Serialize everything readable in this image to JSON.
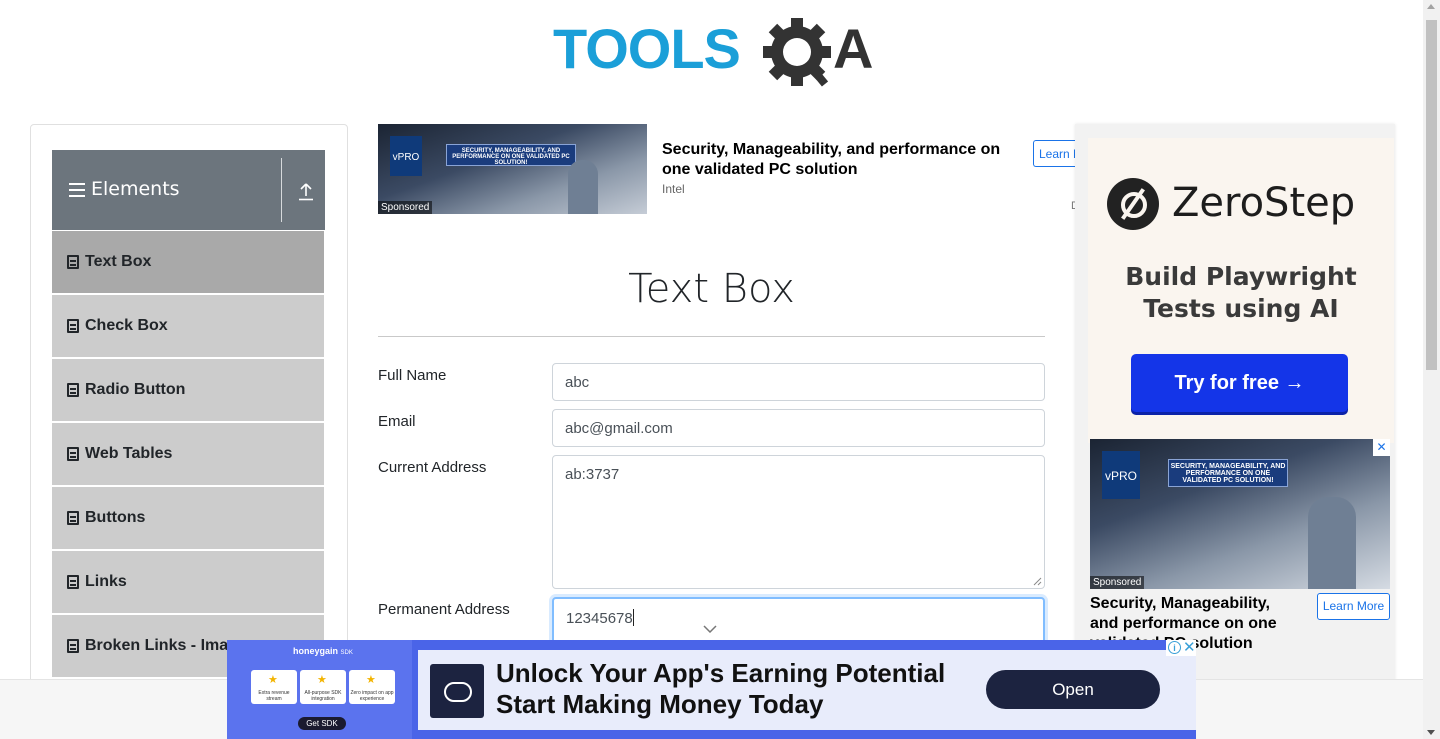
{
  "header": {
    "logo_text_a": "TOOLS",
    "logo_text_b": "A",
    "colors": {
      "logo_blue": "#1b9fd8",
      "logo_dark": "#333333"
    }
  },
  "sidebar": {
    "group_title": "Elements",
    "menu_icon": "hamburger-icon",
    "collapse_icon": "upload-icon",
    "items": [
      {
        "label": "Text Box",
        "icon": "list-icon",
        "active": true
      },
      {
        "label": "Check Box",
        "icon": "list-icon"
      },
      {
        "label": "Radio Button",
        "icon": "list-icon"
      },
      {
        "label": "Web Tables",
        "icon": "list-icon"
      },
      {
        "label": "Buttons",
        "icon": "list-icon"
      },
      {
        "label": "Links",
        "icon": "list-icon"
      },
      {
        "label": "Broken Links - Images",
        "icon": "list-icon"
      }
    ]
  },
  "top_ad": {
    "brand_badge": "vPRO",
    "banner_text": "SECURITY, MANAGEABILITY, AND PERFORMANCE ON ONE VALIDATED PC SOLUTION!",
    "sponsored": "Sponsored",
    "headline": "Security, Manageability, and performance on one validated PC solution",
    "source": "Intel",
    "cta": "Learn M",
    "badge": "D"
  },
  "form": {
    "title": "Text Box",
    "full_name": {
      "label": "Full Name",
      "value": "abc"
    },
    "email": {
      "label": "Email",
      "value": "abc@gmail.com"
    },
    "current_address": {
      "label": "Current Address",
      "value": "ab:3737"
    },
    "permanent_address": {
      "label": "Permanent Address",
      "value": "12345678"
    }
  },
  "right_ad": {
    "brand": "ZeroStep",
    "tagline": "Build Playwright Tests using AI",
    "cta": "Try for free →",
    "image_badge": "vPRO",
    "image_banner": "SECURITY, MANAGEABILITY, AND PERFORMANCE ON ONE VALIDATED PC SOLUTION!",
    "sponsored": "Sponsored",
    "headline": "Security, Manageability, and performance on one validated PC solution",
    "learn_more": "Learn More",
    "close": "✕"
  },
  "bottom_ad": {
    "brand": "honeygain",
    "brand_suffix": "SDK",
    "cards": [
      "Extra revenue stream",
      "All-purpose SDK integration",
      "Zero impact on app experience"
    ],
    "get_sdk": "Get SDK",
    "headline_line1": "Unlock Your App's Earning Potential",
    "headline_line2": "Start Making Money Today",
    "cta": "Open",
    "info": "i",
    "close": "✕",
    "colors": {
      "bg": "#4a64e8",
      "dark": "#1c2340"
    }
  }
}
